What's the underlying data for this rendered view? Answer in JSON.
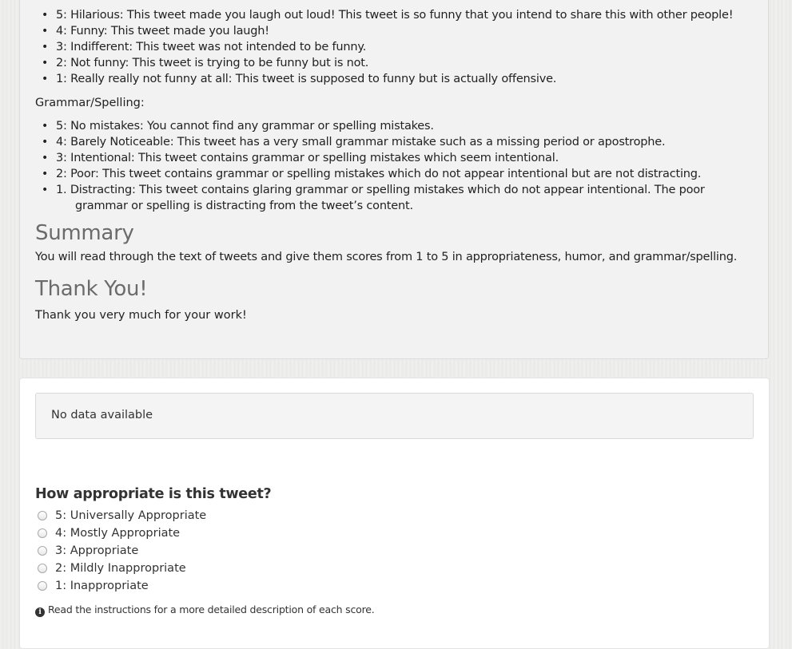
{
  "humor_ratings": [
    "5: Hilarious: This tweet made you laugh out loud! This tweet is so funny that you intend to share this with other people!",
    "4: Funny: This tweet made you laugh!",
    "3: Indifferent: This tweet was not intended to be funny.",
    "2: Not funny: This tweet is trying to be funny but is not.",
    "1: Really really not funny at all: This tweet is supposed to funny but is actually offensive."
  ],
  "grammar_label": "Grammar/Spelling:",
  "grammar_ratings": [
    "5: No mistakes: You cannot find any grammar or spelling mistakes.",
    "4: Barely Noticeable: This tweet has a very small grammar mistake such as a missing period or apostrophe.",
    "3: Intentional: This tweet contains grammar or spelling mistakes which seem intentional.",
    "2: Poor: This tweet contains grammar or spelling mistakes which do not appear intentional but are not distracting.",
    "1.  Distracting: This tweet contains glaring grammar or spelling mistakes which do not appear intentional. The poor grammar or spelling is distracting from the tweet’s content."
  ],
  "summary": {
    "heading": "Summary",
    "text": "You will read through the text of tweets and give them scores from 1 to 5 in appropriateness, humor, and grammar/spelling."
  },
  "thanks": {
    "heading": "Thank You!",
    "text": "Thank you very much for your work!"
  },
  "tweet_box": {
    "text": "No data available"
  },
  "question": {
    "title": "How appropriate is this tweet?",
    "options": [
      "5: Universally Appropriate",
      "4: Mostly Appropriate",
      "3: Appropriate",
      "2: Mildly Inappropriate",
      "1: Inappropriate"
    ],
    "hint": "Read the instructions for a more detailed description of each score.",
    "hint_icon": "info-circle-icon"
  }
}
